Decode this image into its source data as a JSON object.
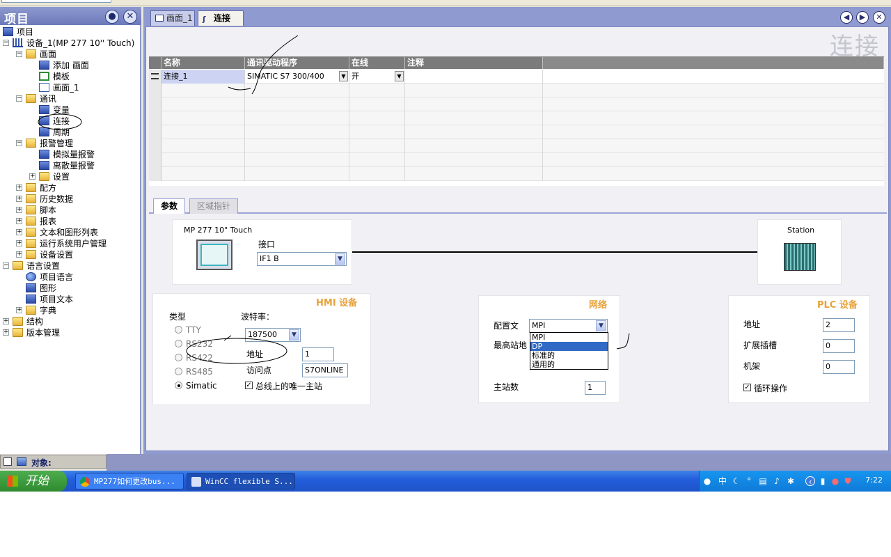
{
  "left_panel": {
    "title": "项目",
    "pin_icon": "pin-icon",
    "close_icon": "close-icon",
    "tree": [
      {
        "label": "项目",
        "level": 0,
        "icon": "project-icon",
        "expander": ""
      },
      {
        "label": "设备_1(MP 277 10'' Touch)",
        "level": 0,
        "icon": "device-icon",
        "expander": "−"
      },
      {
        "label": "画面",
        "level": 1,
        "icon": "folder-icon",
        "expander": "−"
      },
      {
        "label": "添加 画面",
        "level": 2,
        "icon": "add-screen-icon",
        "expander": ""
      },
      {
        "label": "模板",
        "level": 2,
        "icon": "template-icon",
        "expander": ""
      },
      {
        "label": "画面_1",
        "level": 2,
        "icon": "screen-icon",
        "expander": ""
      },
      {
        "label": "通讯",
        "level": 1,
        "icon": "folder-icon",
        "expander": "−"
      },
      {
        "label": "变量",
        "level": 2,
        "icon": "tags-icon",
        "expander": ""
      },
      {
        "label": "连接",
        "level": 2,
        "icon": "connection-icon",
        "expander": ""
      },
      {
        "label": "周期",
        "level": 2,
        "icon": "cycle-icon",
        "expander": ""
      },
      {
        "label": "报警管理",
        "level": 1,
        "icon": "folder-icon",
        "expander": "−"
      },
      {
        "label": "模拟量报警",
        "level": 2,
        "icon": "alarm-icon",
        "expander": ""
      },
      {
        "label": "离散量报警",
        "level": 2,
        "icon": "alarm-icon",
        "expander": ""
      },
      {
        "label": "设置",
        "level": 2,
        "icon": "folder-icon",
        "expander": "+"
      },
      {
        "label": "配方",
        "level": 1,
        "icon": "folder-icon",
        "expander": "+"
      },
      {
        "label": "历史数据",
        "level": 1,
        "icon": "folder-icon",
        "expander": "+"
      },
      {
        "label": "脚本",
        "level": 1,
        "icon": "folder-icon",
        "expander": "+"
      },
      {
        "label": "报表",
        "level": 1,
        "icon": "folder-icon",
        "expander": "+"
      },
      {
        "label": "文本和图形列表",
        "level": 1,
        "icon": "folder-icon",
        "expander": "+"
      },
      {
        "label": "运行系统用户管理",
        "level": 1,
        "icon": "folder-icon",
        "expander": "+"
      },
      {
        "label": "设备设置",
        "level": 1,
        "icon": "folder-icon",
        "expander": "+"
      },
      {
        "label": "语言设置",
        "level": 0,
        "icon": "folder-icon",
        "expander": "−"
      },
      {
        "label": "项目语言",
        "level": 1,
        "icon": "globe-icon",
        "expander": ""
      },
      {
        "label": "图形",
        "level": 1,
        "icon": "graphics-icon",
        "expander": ""
      },
      {
        "label": "项目文本",
        "level": 1,
        "icon": "text-icon",
        "expander": ""
      },
      {
        "label": "字典",
        "level": 1,
        "icon": "folder-icon",
        "expander": "+"
      },
      {
        "label": "结构",
        "level": 0,
        "icon": "folder-icon",
        "expander": "+"
      },
      {
        "label": "版本管理",
        "level": 0,
        "icon": "folder-icon",
        "expander": "+"
      }
    ],
    "objects_label": "对象:"
  },
  "tabs": [
    {
      "label": "画面_1",
      "active": false
    },
    {
      "label": "连接",
      "active": true
    }
  ],
  "editor_title": "连接",
  "table": {
    "headers": [
      "名称",
      "通讯驱动程序",
      "在线",
      "注释"
    ],
    "rows": [
      {
        "name": "连接_1",
        "driver": "SIMATIC S7 300/400",
        "online": "开",
        "comment": ""
      }
    ]
  },
  "param_tabs": [
    "参数",
    "区域指针"
  ],
  "hmi_device_box": {
    "device_name": "MP 277 10\" Touch",
    "interface_label": "接口",
    "interface_value": "IF1 B"
  },
  "station_box": {
    "label": "Station"
  },
  "hmi_section": {
    "title": "HMI 设备",
    "type_label": "类型",
    "types": [
      {
        "label": "TTY",
        "selected": false
      },
      {
        "label": "RS232",
        "selected": false
      },
      {
        "label": "RS422",
        "selected": false
      },
      {
        "label": "RS485",
        "selected": false
      },
      {
        "label": "Simatic",
        "selected": true
      }
    ],
    "baud_label": "波特率：",
    "baud_value": "187500",
    "address_label": "地址",
    "address_value": "1",
    "access_point_label": "访问点",
    "access_point_value": "S7ONLINE",
    "single_master_label": "总线上的唯一主站",
    "single_master_checked": true
  },
  "network_section": {
    "title": "网络",
    "profile_label": "配置文",
    "profile_value": "MPI",
    "highest_station_label": "最高站地",
    "masters_label": "主站数",
    "masters_value": "1",
    "profile_options": [
      "MPI",
      "DP",
      "标准的",
      "通用的"
    ],
    "highlighted_option": "DP"
  },
  "plc_section": {
    "title": "PLC 设备",
    "address_label": "地址",
    "address_value": "2",
    "slot_label": "扩展插槽",
    "slot_value": "0",
    "rack_label": "机架",
    "rack_value": "0",
    "cyclic_label": "循环操作",
    "cyclic_checked": true
  },
  "taskbar": {
    "start_label": "开始",
    "tasks": [
      {
        "label": "MP277如何更改bus..."
      },
      {
        "label": "WinCC flexible S..."
      }
    ],
    "tray_ime": "中",
    "clock": "7:22"
  }
}
